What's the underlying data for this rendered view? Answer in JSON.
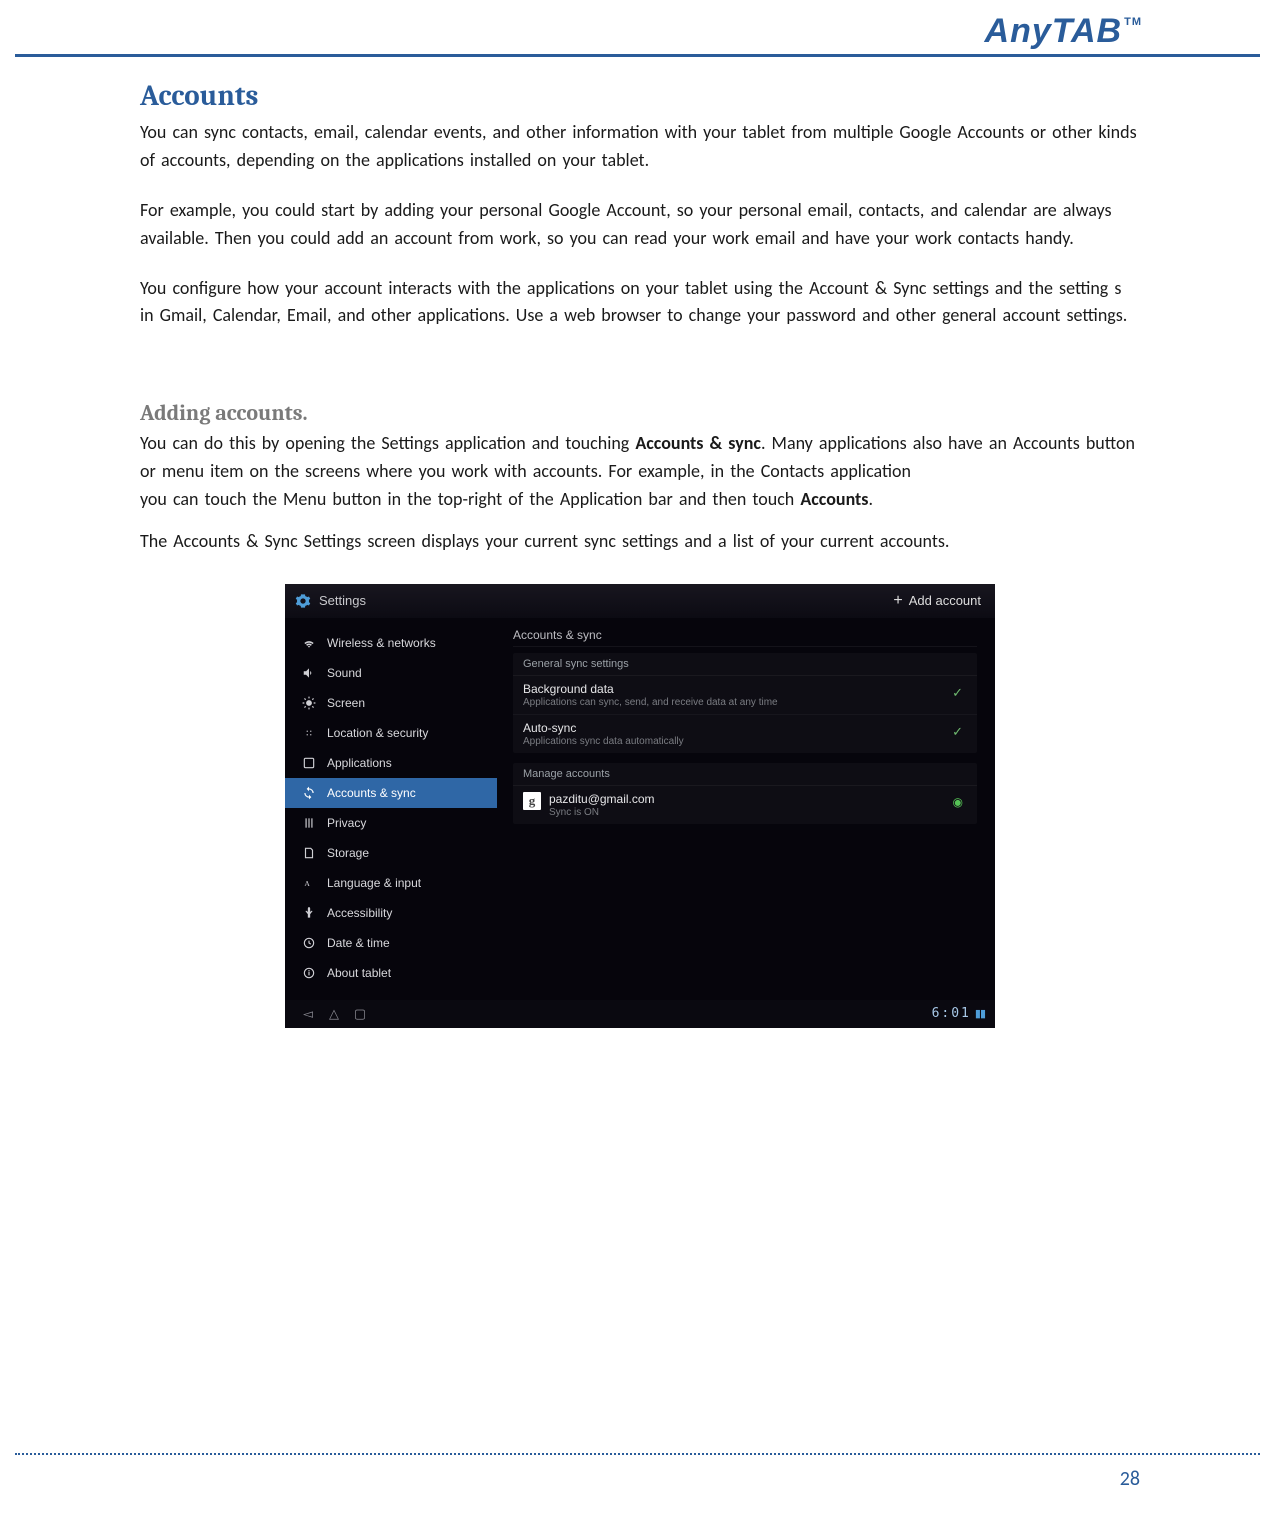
{
  "brand": {
    "name": "AnyTAB",
    "mark": "TM"
  },
  "headings": {
    "accounts": "Accounts",
    "adding": "Adding accounts."
  },
  "paragraphs": {
    "p1": "You can  sync  contacts, email,  calendar events,  and  other  information  with your tablet  from multiple Google Accounts  or other  kinds of accounts, depending on the applications installed on your tablet.",
    "p2": "For example,  you could  start  by adding  your personal  Google Account,  so your personal  email,  contacts, and  calendar are always available.  Then you could  add  an account from work, so you can  read  your work email  and  have  your work contacts handy.",
    "p3": "You configure  how your account interacts with the  applications on your tablet  using the  Account  & Sync settings and  the  setting  s in Gmail, Calendar,  Email,  and  other applications. Use  a  web browser  to  change your password  and  other  general account settings.",
    "p4a": "You can  do this  by opening  the  Settings application and  touching  ",
    "p4b": "Accounts & sync",
    "p4c": ".  Many applications also have an  Accounts  button  or menu  item  on the screens where you work with accounts. For example,  in the Contacts  application",
    "p5a": "you can  touch  the  Menu button in the  top-right  of the  Application  bar and  then touch  ",
    "p5b": "Accounts",
    "p5c": ".",
    "p6": "The Accounts  & Sync Settings  screen  displays  your current  sync settings and  a list of your current  accounts."
  },
  "screenshot": {
    "title": "Settings",
    "add_account": "Add account",
    "sidebar": [
      {
        "icon": "wifi",
        "label": "Wireless & networks"
      },
      {
        "icon": "sound",
        "label": "Sound"
      },
      {
        "icon": "screen",
        "label": "Screen"
      },
      {
        "icon": "location",
        "label": "Location & security"
      },
      {
        "icon": "apps",
        "label": "Applications"
      },
      {
        "icon": "sync",
        "label": "Accounts & sync"
      },
      {
        "icon": "privacy",
        "label": "Privacy"
      },
      {
        "icon": "storage",
        "label": "Storage"
      },
      {
        "icon": "lang",
        "label": "Language & input"
      },
      {
        "icon": "access",
        "label": "Accessibility"
      },
      {
        "icon": "date",
        "label": "Date & time"
      },
      {
        "icon": "about",
        "label": "About tablet"
      }
    ],
    "crumb": "Accounts & sync",
    "general_hdr": "General sync settings",
    "bg": {
      "title": "Background data",
      "sub": "Applications can sync, send, and receive data at any time"
    },
    "auto": {
      "title": "Auto-sync",
      "sub": "Applications sync data automatically"
    },
    "manage_hdr": "Manage accounts",
    "account": {
      "email": "pazditu@gmail.com",
      "status": "Sync is ON"
    },
    "clock": "6:01"
  },
  "page_number": "28"
}
